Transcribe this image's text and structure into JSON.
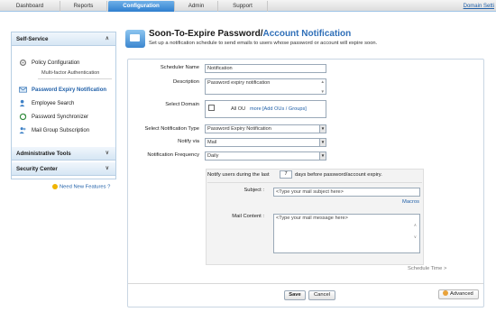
{
  "topnav": {
    "tabs": [
      {
        "label": "Dashboard"
      },
      {
        "label": "Reports"
      },
      {
        "label": "Configuration",
        "active": true
      },
      {
        "label": "Admin"
      },
      {
        "label": "Support"
      }
    ],
    "domain_link": "Domain Setti"
  },
  "sidebar": {
    "self_service_header": "Self-Service",
    "items": [
      {
        "label": "Policy Configuration",
        "icon": "gear-icon"
      },
      {
        "label": "Multi-factor Authentication",
        "sub": true
      },
      {
        "label": "Password Expiry Notification",
        "icon": "mail-icon",
        "active": true
      },
      {
        "label": "Employee Search",
        "icon": "search-user-icon"
      },
      {
        "label": "Password Synchronizer",
        "icon": "sync-icon"
      },
      {
        "label": "Mail Group Subscription",
        "icon": "group-icon"
      }
    ],
    "admin_tools_header": "Administrative Tools",
    "security_center_header": "Security Center",
    "new_features": "Need New Features ?"
  },
  "header": {
    "title_plain": "Soon-To-Expire Password/",
    "title_accent": "Account Notification",
    "description": "Set up a notification schedule to send emails to users whose password or account will expire soon."
  },
  "form": {
    "scheduler_name_label": "Scheduler Name",
    "scheduler_name_value": "Notification",
    "description_label": "Description",
    "description_value": "Password expiry notification",
    "select_domain_label": "Select Domain",
    "domain_value": "All OU",
    "domain_more": "more",
    "domain_add_ous": "[Add OUs / Groups]",
    "notification_type_label": "Select Notification Type",
    "notification_type_value": "Password Expiry Notification",
    "notify_via_label": "Notify via",
    "notify_via_value": "Mail",
    "frequency_label": "Notification Frequency",
    "frequency_value": "Daily",
    "notify_prefix": "Notify users during the last",
    "notify_days": "7",
    "notify_suffix": "days before password/account expiry.",
    "subject_label": "Subject :",
    "subject_placeholder": "<Type your mail subject here>",
    "macros_link": "Macros",
    "mail_content_label": "Mail Content :",
    "mail_content_placeholder": "<Type your mail message here>",
    "schedule_time_link": "Schedule Time >",
    "save_button": "Save",
    "cancel_button": "Cancel",
    "advanced_button": "Advanced"
  },
  "colors": {
    "accent": "#2f7fcf",
    "link": "#1f5fa8"
  }
}
